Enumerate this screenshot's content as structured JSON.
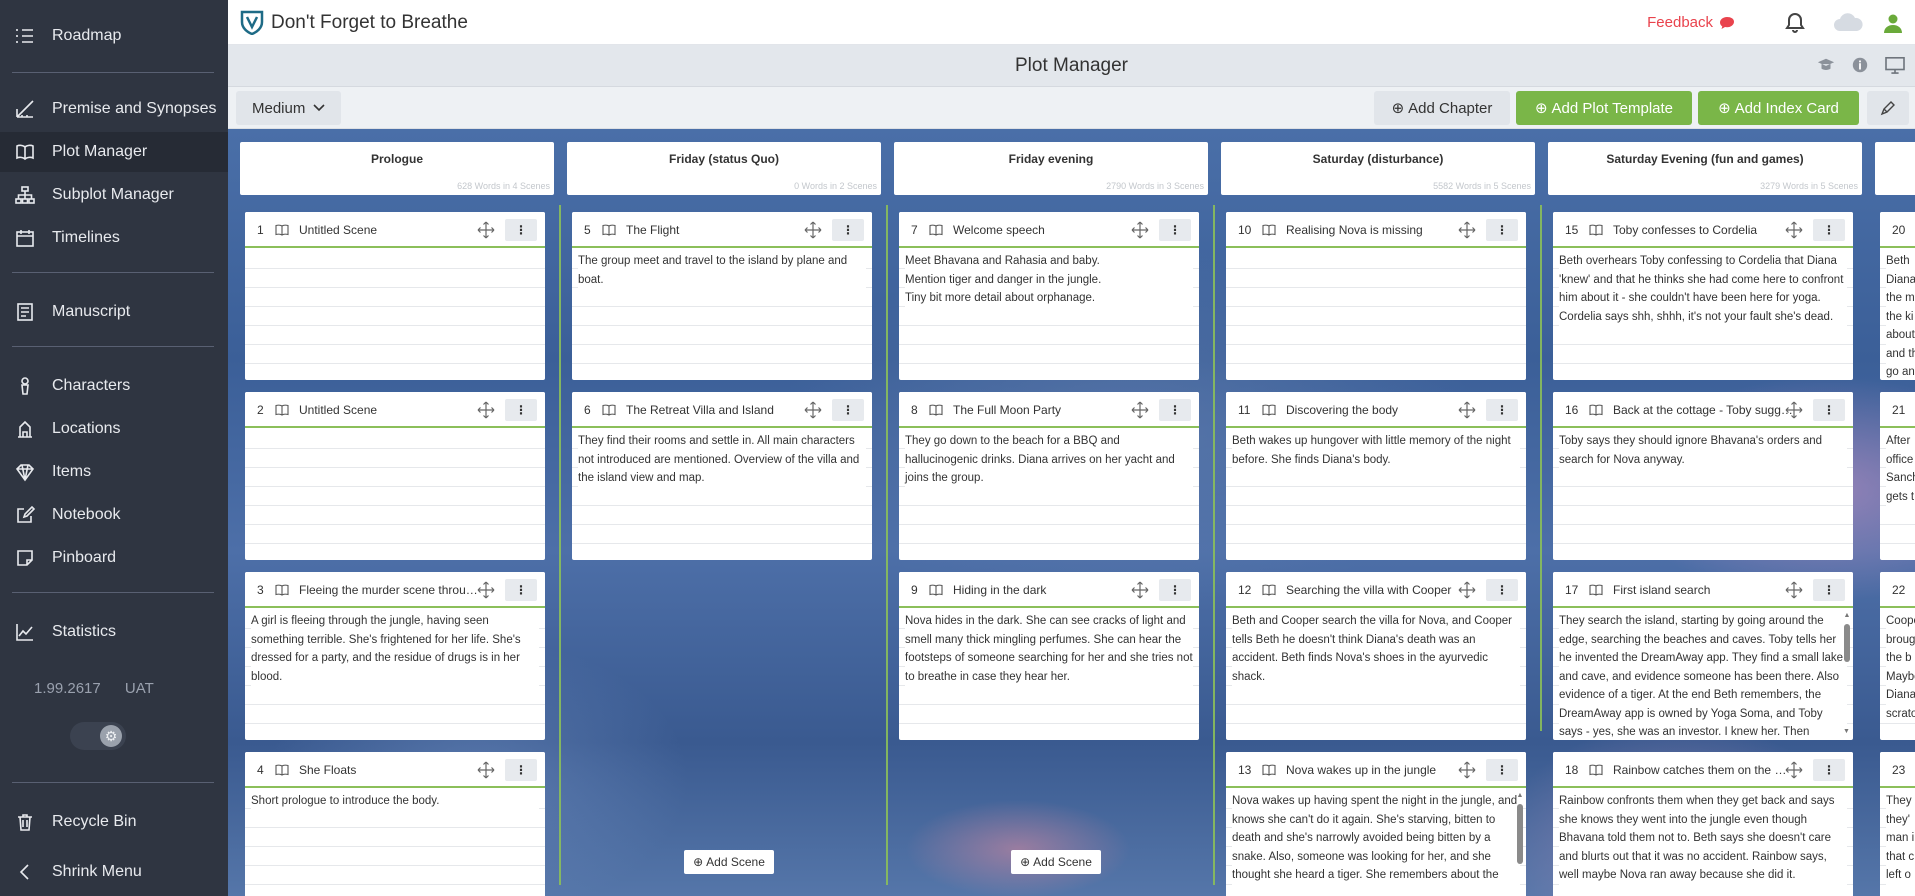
{
  "sidebar": {
    "items": [
      {
        "label": "Roadmap",
        "icon": "list-icon"
      },
      {
        "label": "Premise and Synopses",
        "icon": "ruler-icon"
      },
      {
        "label": "Plot Manager",
        "icon": "book-icon"
      },
      {
        "label": "Subplot Manager",
        "icon": "sitemap-icon"
      },
      {
        "label": "Timelines",
        "icon": "calendar-icon"
      },
      {
        "label": "Manuscript",
        "icon": "manuscript-icon"
      },
      {
        "label": "Characters",
        "icon": "character-icon"
      },
      {
        "label": "Locations",
        "icon": "location-icon"
      },
      {
        "label": "Items",
        "icon": "diamond-icon"
      },
      {
        "label": "Notebook",
        "icon": "notebook-icon"
      },
      {
        "label": "Pinboard",
        "icon": "pinboard-icon"
      },
      {
        "label": "Statistics",
        "icon": "statistics-icon"
      },
      {
        "label": "Recycle Bin",
        "icon": "trash-icon"
      },
      {
        "label": "Shrink Menu",
        "icon": "chevron-left-icon"
      }
    ],
    "version": "1.99.2617",
    "env": "UAT"
  },
  "topbar": {
    "title": "Don't Forget to Breathe",
    "feedback": "Feedback"
  },
  "subheader": {
    "title": "Plot Manager"
  },
  "toolbar": {
    "size_select": "Medium",
    "add_chapter": "Add Chapter",
    "add_plot_template": "Add Plot Template",
    "add_index_card": "Add Index Card"
  },
  "board": {
    "add_scene": "Add Scene",
    "chapters": [
      {
        "title": "Prologue",
        "stats": "628 Words in 4 Scenes",
        "scenes": [
          {
            "num": "1",
            "title": "Untitled Scene",
            "text": ""
          },
          {
            "num": "2",
            "title": "Untitled Scene",
            "text": ""
          },
          {
            "num": "3",
            "title": "Fleeing the murder scene through ...",
            "text": "A girl is fleeing through the jungle, having seen something terrible. She's frightened for her life. She's dressed for a party, and the residue of drugs is in her blood."
          },
          {
            "num": "4",
            "title": "She Floats",
            "text": "Short prologue to introduce the body."
          }
        ]
      },
      {
        "title": "Friday (status Quo)",
        "stats": "0 Words in 2 Scenes",
        "scenes": [
          {
            "num": "5",
            "title": "The Flight",
            "text": "The group meet and travel to the island by plane and boat."
          },
          {
            "num": "6",
            "title": "The Retreat Villa and Island",
            "text": "They find their rooms and settle in. All main characters not introduced are mentioned. Overview of the villa and the island view and map."
          }
        ]
      },
      {
        "title": "Friday evening",
        "stats": "2790 Words in 3 Scenes",
        "scenes": [
          {
            "num": "7",
            "title": "Welcome speech",
            "text": "Meet Bhavana and Rahasia and baby.\nMention tiger and danger in the jungle.\nTiny bit more detail about orphanage."
          },
          {
            "num": "8",
            "title": "The Full Moon Party",
            "text": "They go down to the beach for a BBQ and hallucinogenic drinks. Diana arrives on her yacht and joins the group."
          },
          {
            "num": "9",
            "title": "Hiding in the dark",
            "text": "Nova hides in the dark. She can see cracks of light and smell many thick mingling perfumes. She can hear the footsteps of someone searching for her and she tries not to breathe in case they hear her."
          }
        ]
      },
      {
        "title": "Saturday (disturbance)",
        "stats": "5582 Words in 5 Scenes",
        "scenes": [
          {
            "num": "10",
            "title": "Realising Nova is missing",
            "text": ""
          },
          {
            "num": "11",
            "title": "Discovering the body",
            "text": "Beth wakes up hungover with little memory of the night before. She finds Diana's body."
          },
          {
            "num": "12",
            "title": "Searching the villa with Cooper",
            "text": "Beth and Cooper search the villa for Nova, and Cooper tells Beth he doesn't think Diana's death was an accident. Beth finds Nova's shoes in the ayurvedic shack."
          },
          {
            "num": "13",
            "title": "Nova wakes up in the jungle",
            "text": "Nova wakes up having spent the night in the jungle, and knows she can't do it again. She's starving, bitten to death and she's narrowly avoided being bitten by a snake. Also, someone was looking for her, and she thought she heard a tiger. She remembers about the"
          }
        ]
      },
      {
        "title": "Saturday Evening (fun and games)",
        "stats": "3279 Words in 5 Scenes",
        "scenes": [
          {
            "num": "15",
            "title": "Toby confesses to Cordelia",
            "text": "Beth overhears Toby confessing to Cordelia that Diana 'knew' and that he thinks she had come here to confront him about it - she couldn't have been here for yoga. Cordelia says shh, shhh, it's not your fault she's dead."
          },
          {
            "num": "16",
            "title": "Back at the cottage - Toby sugges...",
            "text": "Toby says they should ignore Bhavana's orders and search for Nova anyway."
          },
          {
            "num": "17",
            "title": "First island search",
            "text": "They search the island, starting by going around the edge, searching the beaches and caves. Toby tells her he invented the DreamAway app. They find a small lake and cave, and evidence someone has been there. Also evidence of a tiger. At the end Beth remembers, the DreamAway app is owned by Yoga Soma, and Toby says - yes, she was an investor. I knew her. Then"
          },
          {
            "num": "18",
            "title": "Rainbow catches them on the wa...",
            "text": "Rainbow confronts them when they get back and says she knows they went into the jungle even though Bhavana told them not to. Beth says she doesn't care and blurts out that it was no accident. Rainbow says, well maybe Nova ran away because she did it."
          }
        ]
      },
      {
        "title": "",
        "stats": "",
        "scenes": [
          {
            "num": "20",
            "title": "",
            "text": "Beth\nDiana\nthe m\nthe ki\nabout\nand th\ngo an"
          },
          {
            "num": "21",
            "title": "",
            "text": "After\noffice\nSanch\ngets t"
          },
          {
            "num": "22",
            "title": "",
            "text": "Coope\nbroug\nthe b\nMaybe\nDiana\nscrato"
          },
          {
            "num": "23",
            "title": "",
            "text": "They\nthey'\nman i\nthat c\nleft o"
          }
        ]
      }
    ]
  }
}
